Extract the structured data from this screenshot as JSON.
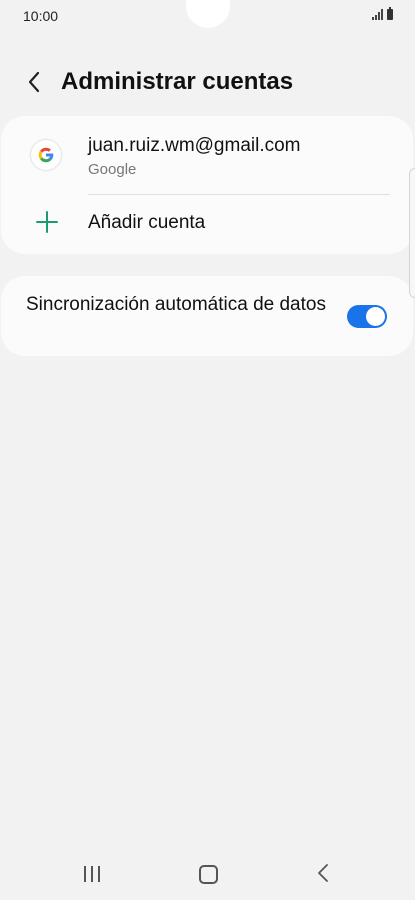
{
  "status_bar": {
    "time": "10:00"
  },
  "header": {
    "title": "Administrar cuentas"
  },
  "accounts": {
    "email": "juan.ruiz.wm@gmail.com",
    "type": "Google",
    "google_icon_letter": "G",
    "add_label": "Añadir cuenta"
  },
  "sync": {
    "label": "Sincronización automática de datos",
    "enabled": true
  },
  "colors": {
    "accent": "#1a73e8",
    "plus_icon": "#1e9b6e",
    "background": "#f2f2f2",
    "card": "#fbfbfb"
  },
  "icons": [
    "back-arrow-icon",
    "google-icon",
    "plus-icon",
    "signal-icon",
    "battery-icon",
    "recent-apps-icon",
    "home-icon",
    "back-icon"
  ]
}
